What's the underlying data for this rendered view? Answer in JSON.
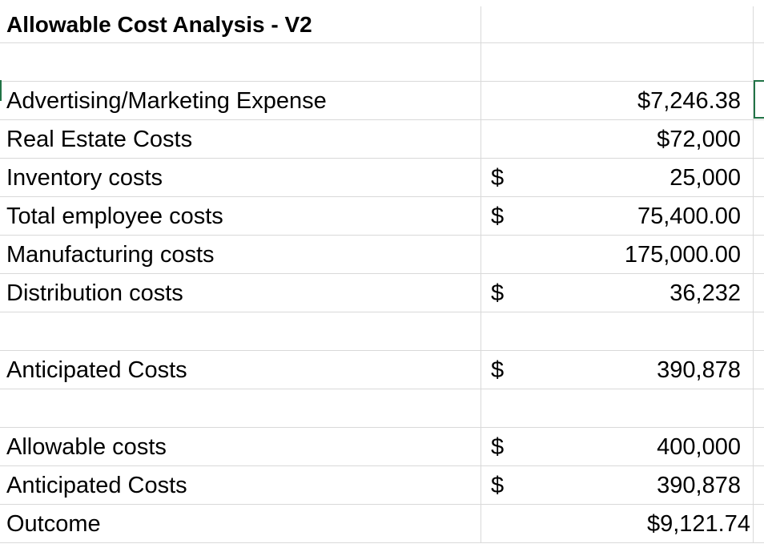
{
  "sheet": {
    "title": "Allowable Cost Analysis - V2",
    "rows": [
      {
        "label": "Advertising/Marketing Expense",
        "currency": "",
        "value": "$7,246.38"
      },
      {
        "label": "Real Estate Costs",
        "currency": "",
        "value": "$72,000"
      },
      {
        "label": "Inventory costs",
        "currency": "$",
        "value": "25,000"
      },
      {
        "label": "Total employee costs",
        "currency": "$",
        "value": "75,400.00"
      },
      {
        "label": "Manufacturing costs",
        "currency": "",
        "value": "175,000.00"
      },
      {
        "label": "Distribution costs",
        "currency": "$",
        "value": "36,232"
      }
    ],
    "anticipated": {
      "label": "Anticipated Costs",
      "currency": "$",
      "value": "390,878"
    },
    "comparison": [
      {
        "label": "Allowable costs",
        "currency": "$",
        "value": "400,000"
      },
      {
        "label": "Anticipated Costs",
        "currency": "$",
        "value": "390,878"
      },
      {
        "label": "Outcome",
        "currency": "",
        "value": "$9,121.74"
      }
    ]
  },
  "colors": {
    "gridline": "#d9d9d9",
    "selection": "#217346"
  }
}
